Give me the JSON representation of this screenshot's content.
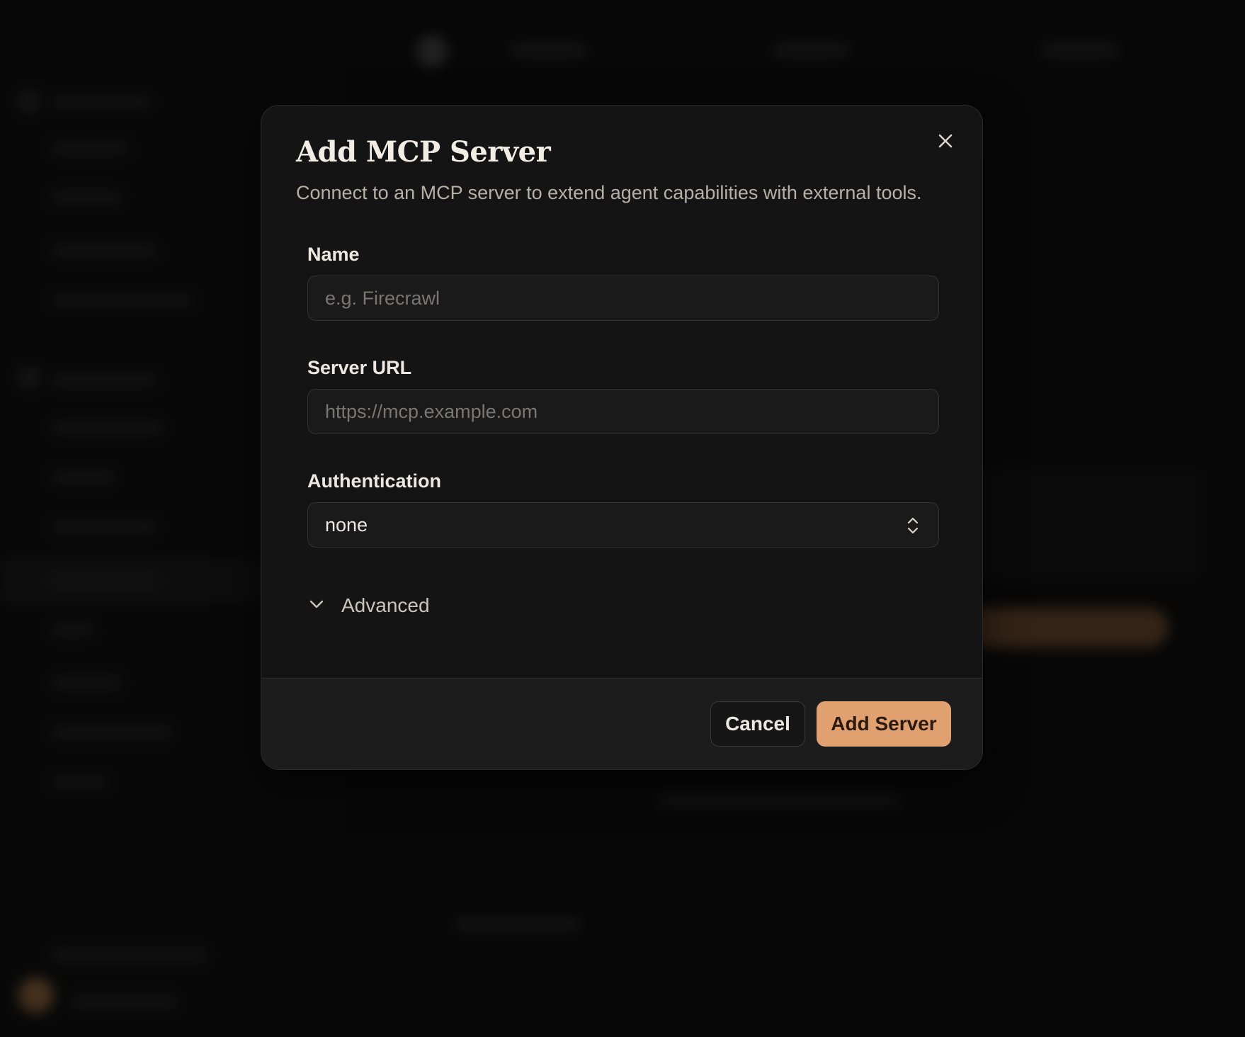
{
  "dialog": {
    "title": "Add MCP Server",
    "description": "Connect to an MCP server to extend agent capabilities with external tools.",
    "close_icon": "close-icon"
  },
  "fields": {
    "name": {
      "label": "Name",
      "value": "",
      "placeholder": "e.g. Firecrawl"
    },
    "server_url": {
      "label": "Server URL",
      "value": "",
      "placeholder": "https://mcp.example.com"
    },
    "authentication": {
      "label": "Authentication",
      "selected": "none",
      "icon": "chevron-up-down-icon"
    }
  },
  "advanced": {
    "label": "Advanced",
    "icon": "chevron-down-icon"
  },
  "footer": {
    "cancel_label": "Cancel",
    "submit_label": "Add Server"
  },
  "colors": {
    "accent": "#e0a070",
    "dialog_bg": "#141414",
    "footer_bg": "#1c1c1c",
    "text_primary": "#ece8e1",
    "text_muted": "#b5b0a8"
  }
}
